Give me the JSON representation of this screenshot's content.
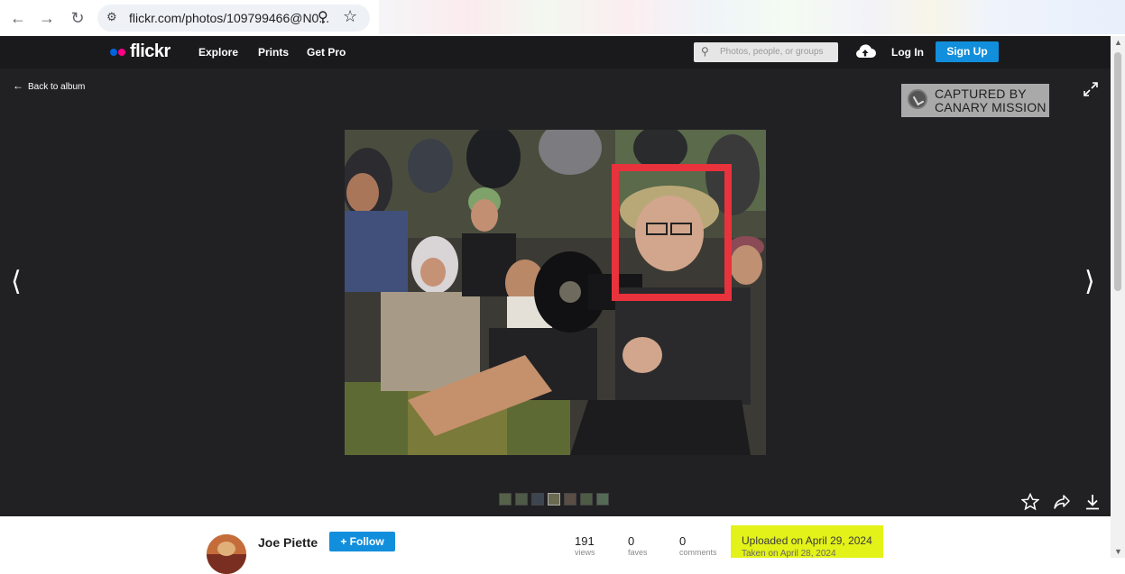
{
  "browser": {
    "url": "flickr.com/photos/109799466@N0...",
    "nav_icons": [
      "back-arrow-icon",
      "forward-arrow-icon",
      "reload-icon"
    ]
  },
  "site": {
    "logo_text": "flickr",
    "logo_colors": {
      "blue": "#0063dc",
      "pink": "#ff0084"
    },
    "nav": [
      "Explore",
      "Prints",
      "Get Pro"
    ],
    "search_placeholder": "Photos, people, or groups",
    "login": "Log In",
    "signup": "Sign Up",
    "accent": "#128fdc"
  },
  "viewer": {
    "back_label": "Back to album",
    "watermark_line1": "CAPTURED BY",
    "watermark_line2": "CANARY MISSION",
    "highlight_color": "#e8323c",
    "thumbnail_count": 7
  },
  "info": {
    "author": "Joe Piette",
    "follow_label": "+ Follow",
    "stats": [
      {
        "value": "191",
        "label": "views"
      },
      {
        "value": "0",
        "label": "faves"
      },
      {
        "value": "0",
        "label": "comments"
      }
    ],
    "uploaded": "Uploaded on April 29, 2024",
    "taken": "Taken on April 28, 2024",
    "uploaded_highlight": "#e3f218"
  }
}
